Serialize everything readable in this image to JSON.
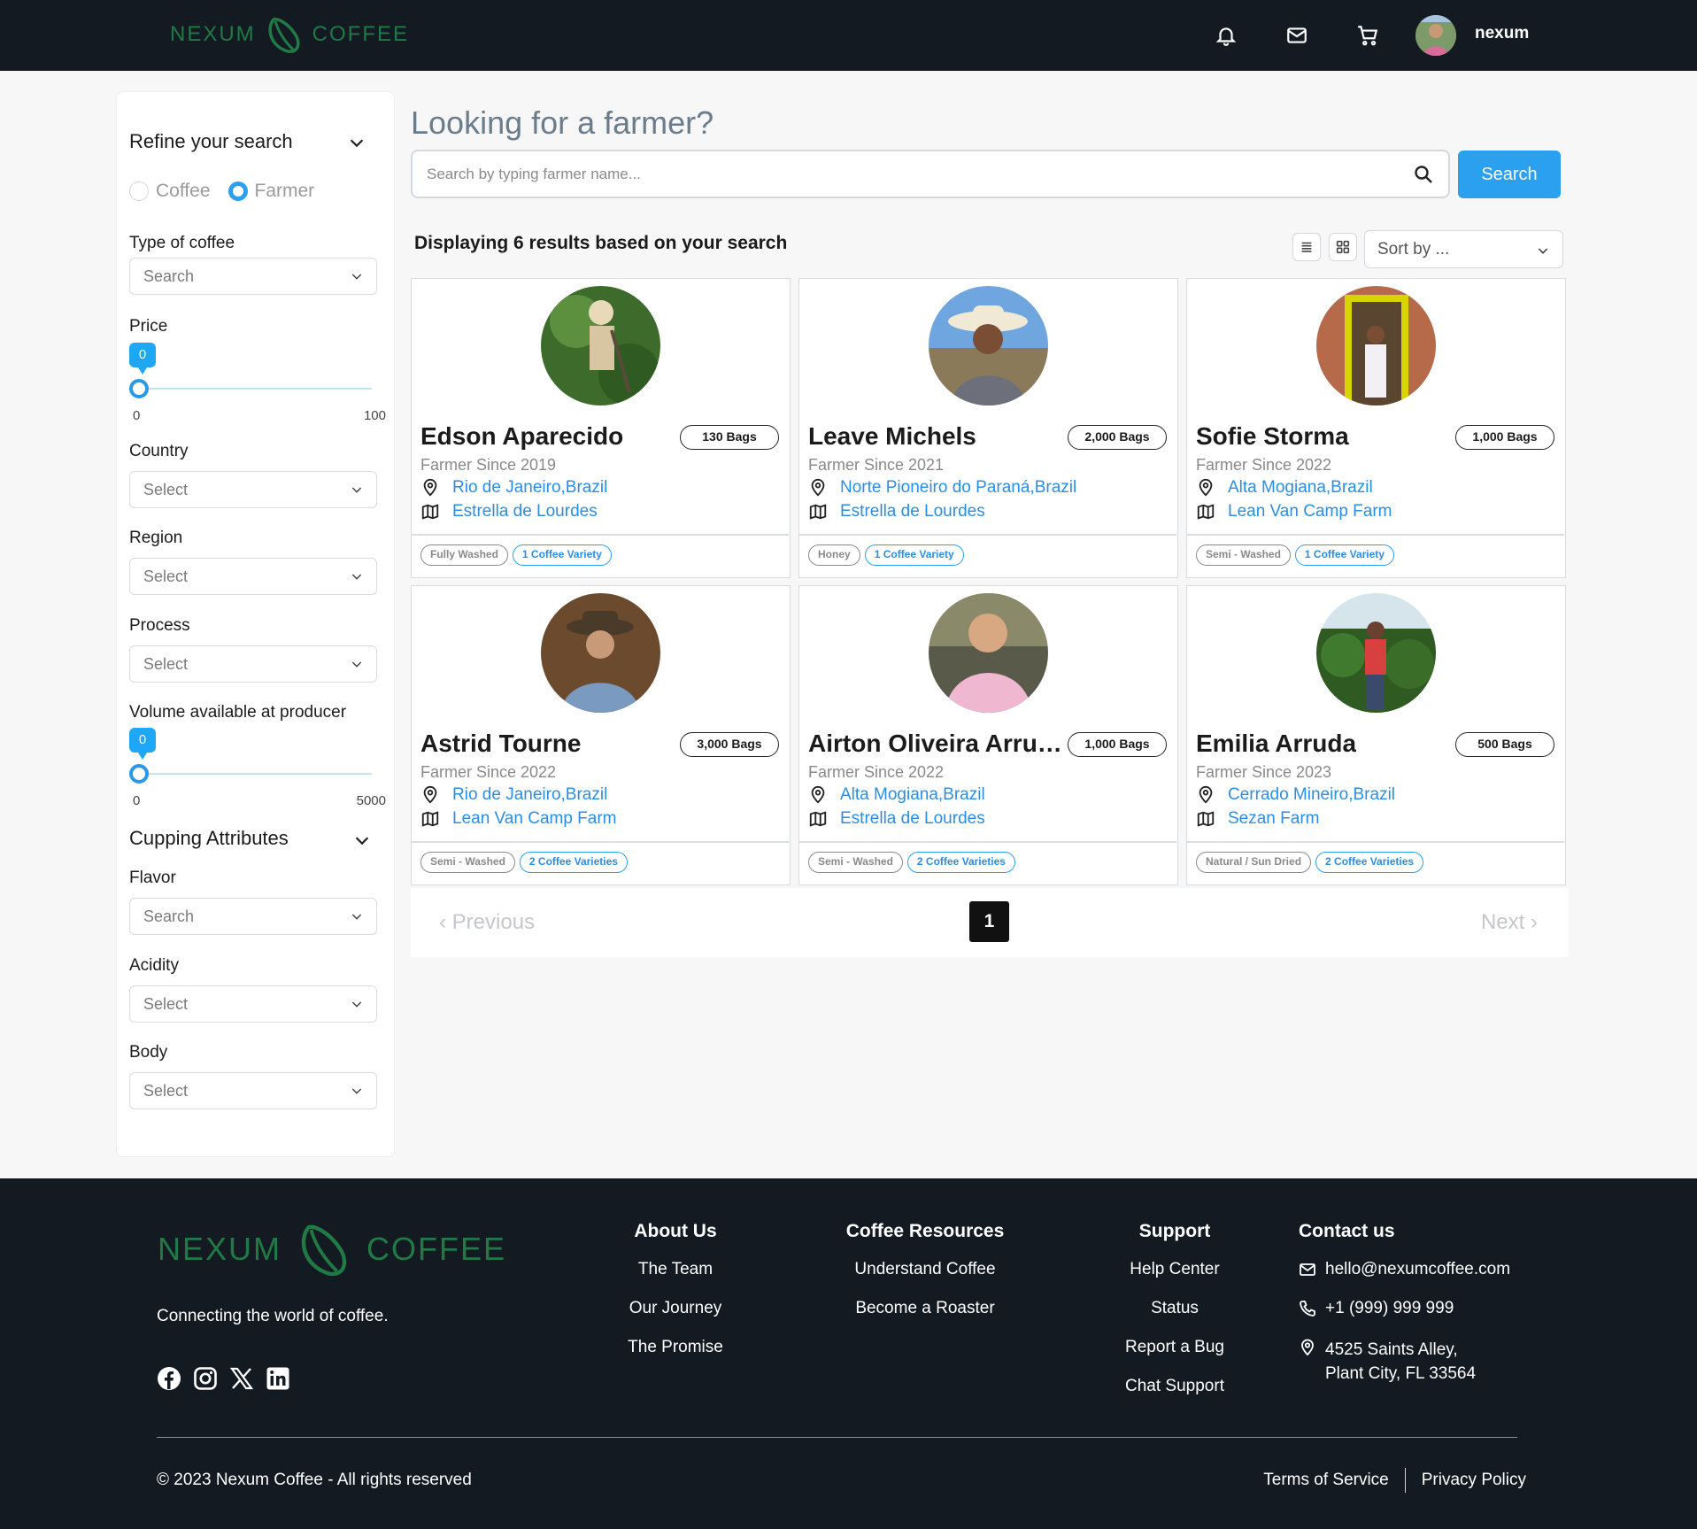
{
  "header": {
    "logo_left": "NEXUM",
    "logo_right": "COFFEE",
    "username": "nexum",
    "brand_color": "#1f7a45"
  },
  "sidebar": {
    "refine_title": "Refine your search",
    "radio_options": [
      "Coffee",
      "Farmer"
    ],
    "selected_radio": "Farmer",
    "type_of_coffee": {
      "label": "Type of coffee",
      "value": "Search"
    },
    "price": {
      "label": "Price",
      "value": "0",
      "min": "0",
      "max": "100"
    },
    "country": {
      "label": "Country",
      "value": "Select"
    },
    "region": {
      "label": "Region",
      "value": "Select"
    },
    "process": {
      "label": "Process",
      "value": "Select"
    },
    "volume": {
      "label": "Volume available at producer",
      "value": "0",
      "min": "0",
      "max": "5000"
    },
    "cupping_title": "Cupping Attributes",
    "flavor": {
      "label": "Flavor",
      "value": "Search"
    },
    "acidity": {
      "label": "Acidity",
      "value": "Select"
    },
    "body": {
      "label": "Body",
      "value": "Select"
    }
  },
  "main": {
    "title": "Looking for a farmer?",
    "search_placeholder": "Search by typing farmer name...",
    "search_button": "Search",
    "results_text": "Displaying 6 results based on your search",
    "sort_label": "Sort by ...",
    "accent_color": "#2aa0ef"
  },
  "farmers": [
    {
      "name": "Edson Aparecido",
      "bags": "130 Bags",
      "since": "Farmer Since 2019",
      "location": "Rio de Janeiro,Brazil",
      "farm": "Estrella de Lourdes",
      "process": "Fully Washed",
      "varieties": "1 Coffee Variety"
    },
    {
      "name": "Leave Michels",
      "bags": "2,000 Bags",
      "since": "Farmer Since 2021",
      "location": "Norte Pioneiro do Paraná,Brazil",
      "farm": "Estrella de Lourdes",
      "process": "Honey",
      "varieties": "1 Coffee Variety"
    },
    {
      "name": "Sofie Storma",
      "bags": "1,000 Bags",
      "since": "Farmer Since 2022",
      "location": "Alta Mogiana,Brazil",
      "farm": "Lean Van Camp Farm",
      "process": "Semi - Washed",
      "varieties": "1 Coffee Variety"
    },
    {
      "name": "Astrid Tourne",
      "bags": "3,000 Bags",
      "since": "Farmer Since 2022",
      "location": "Rio de Janeiro,Brazil",
      "farm": "Lean Van Camp Farm",
      "process": "Semi - Washed",
      "varieties": "2 Coffee Varieties"
    },
    {
      "name": "Airton Oliveira Arruda",
      "bags": "1,000 Bags",
      "since": "Farmer Since 2022",
      "location": "Alta Mogiana,Brazil",
      "farm": "Estrella de Lourdes",
      "process": "Semi - Washed",
      "varieties": "2 Coffee Varieties"
    },
    {
      "name": "Emilia Arruda",
      "bags": "500 Bags",
      "since": "Farmer Since 2023",
      "location": "Cerrado Mineiro,Brazil",
      "farm": "Sezan Farm",
      "process": "Natural / Sun Dried",
      "varieties": "2 Coffee Varieties"
    }
  ],
  "pagination": {
    "previous": "Previous",
    "current": "1",
    "next": "Next"
  },
  "footer": {
    "logo_left": "NEXUM",
    "logo_right": "COFFEE",
    "tagline": "Connecting the world of coffee.",
    "socials": [
      "facebook-icon",
      "instagram-icon",
      "x-icon",
      "linkedin-icon"
    ],
    "about": {
      "title": "About Us",
      "links": [
        "The Team",
        "Our Journey",
        "The Promise"
      ]
    },
    "resources": {
      "title": "Coffee Resources",
      "links": [
        "Understand Coffee",
        "Become a Roaster"
      ]
    },
    "support": {
      "title": "Support",
      "links": [
        "Help Center",
        "Status",
        "Report a Bug",
        "Chat Support"
      ]
    },
    "contact": {
      "title": "Contact us",
      "email": "hello@nexumcoffee.com",
      "phone": "+1 (999) 999 999",
      "address_line1": "4525 Saints Alley,",
      "address_line2": "Plant City, FL 33564"
    },
    "copyright": "© 2023 Nexum Coffee - All rights reserved",
    "terms": "Terms of Service",
    "privacy": "Privacy Policy"
  }
}
